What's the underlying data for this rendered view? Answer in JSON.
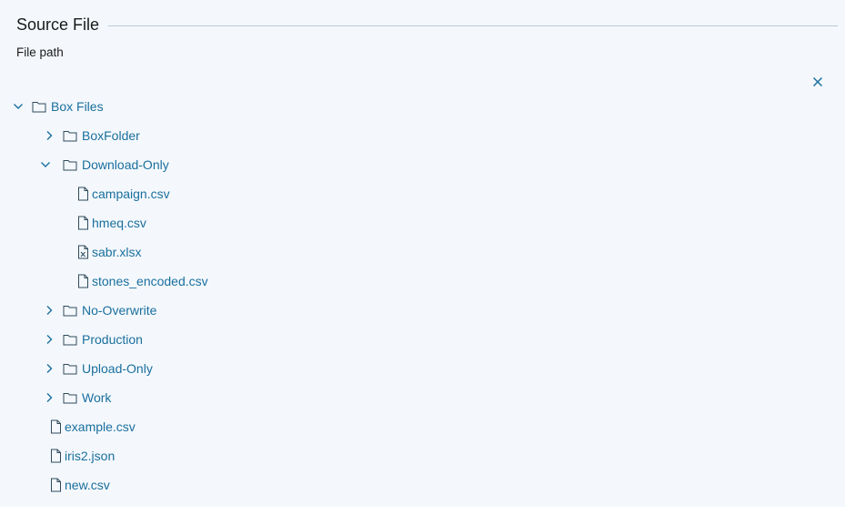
{
  "header": {
    "title": "Source File"
  },
  "field": {
    "label": "File path"
  },
  "tree": {
    "root": {
      "label": "Box Files",
      "expanded": true
    },
    "folders": [
      {
        "label": "BoxFolder",
        "expanded": false
      },
      {
        "label": "Download-Only",
        "expanded": true
      },
      {
        "label": "No-Overwrite",
        "expanded": false
      },
      {
        "label": "Production",
        "expanded": false
      },
      {
        "label": "Upload-Only",
        "expanded": false
      },
      {
        "label": "Work",
        "expanded": false
      }
    ],
    "download_only_files": [
      {
        "label": "campaign.csv",
        "icon": "file-icon"
      },
      {
        "label": "hmeq.csv",
        "icon": "file-icon"
      },
      {
        "label": "sabr.xlsx",
        "icon": "excel-file-icon"
      },
      {
        "label": "stones_encoded.csv",
        "icon": "file-icon"
      }
    ],
    "root_files": [
      {
        "label": "example.csv",
        "icon": "file-icon"
      },
      {
        "label": "iris2.json",
        "icon": "file-icon"
      },
      {
        "label": "new.csv",
        "icon": "file-icon"
      }
    ]
  },
  "colors": {
    "accent": "#1a6f9e",
    "panel_background": "#f4f8fc",
    "divider": "#b9c9d6"
  }
}
